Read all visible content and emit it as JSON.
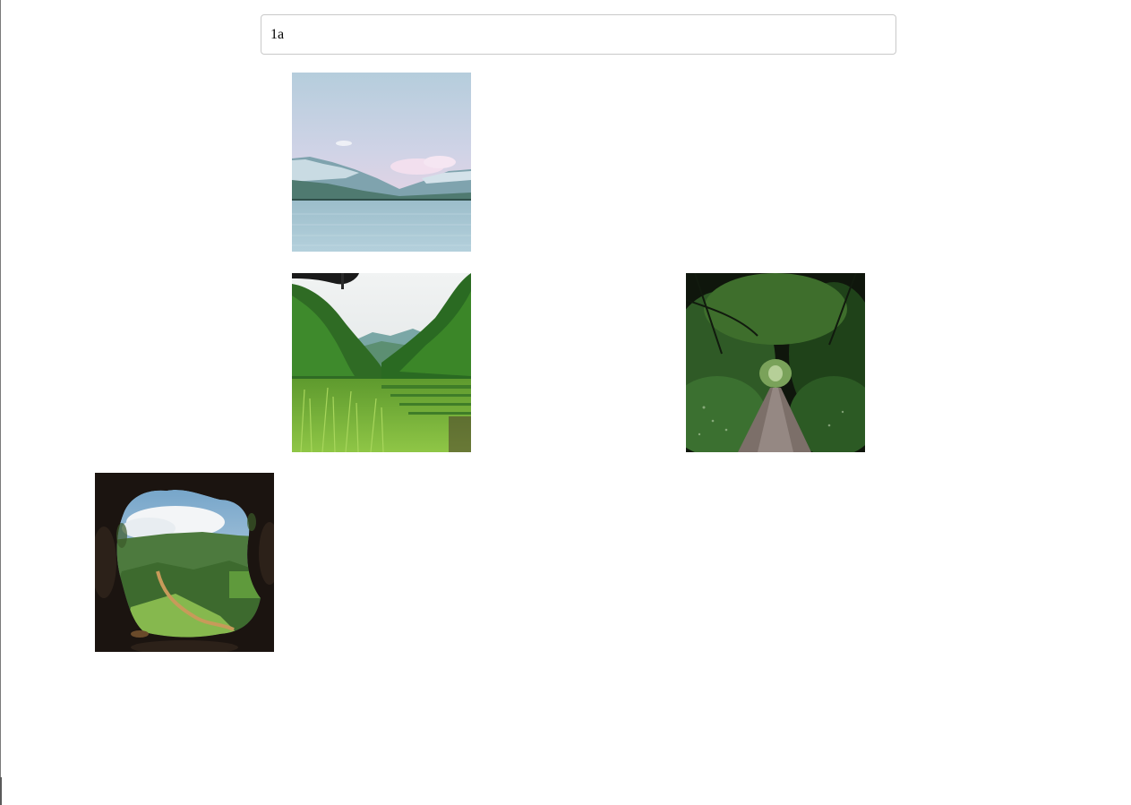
{
  "search": {
    "value": "1a",
    "placeholder": ""
  },
  "results": [
    {
      "subject": "lake-mountains",
      "icon": "photo-icon"
    },
    {
      "subject": "green-valley",
      "icon": "photo-icon"
    },
    {
      "subject": "forest-path",
      "icon": "photo-icon"
    },
    {
      "subject": "cave-view",
      "icon": "photo-icon"
    }
  ],
  "colors": {
    "input_border": "#c9c9c9",
    "background": "#ffffff"
  }
}
